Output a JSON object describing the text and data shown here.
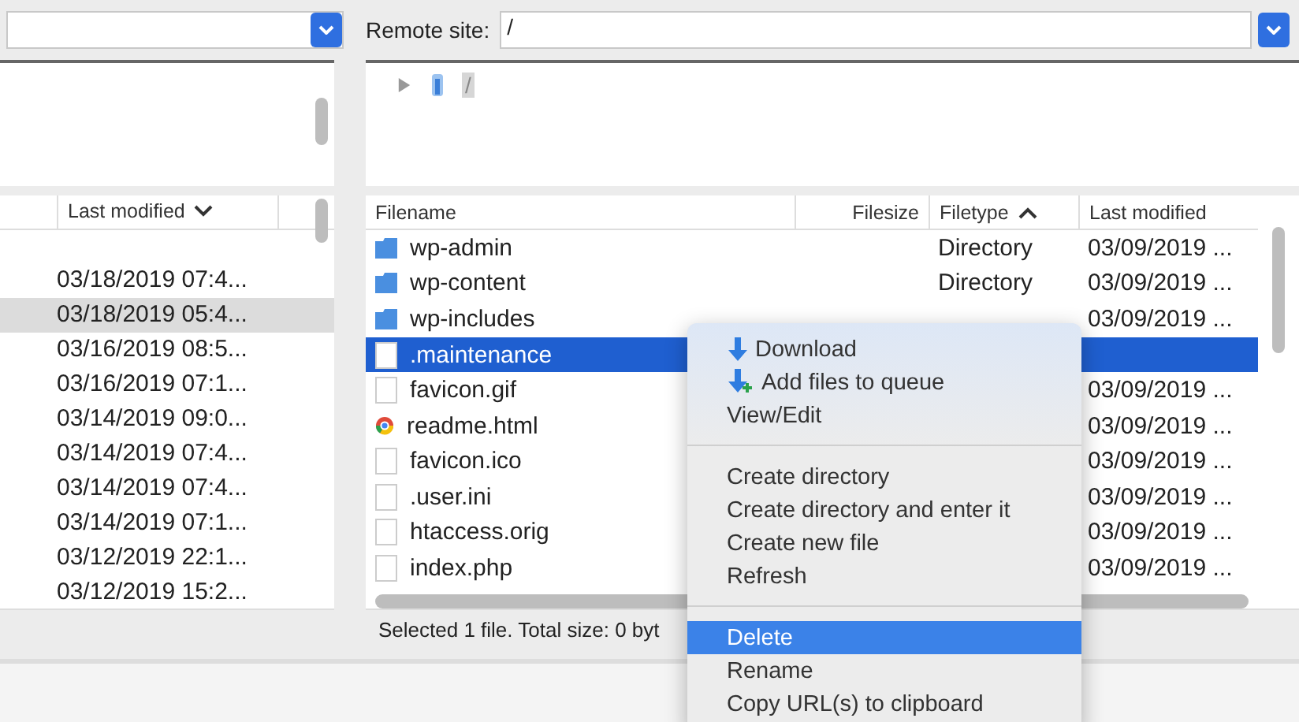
{
  "local_site": {
    "dropdown": {
      "open": false
    }
  },
  "remote_site": {
    "label": "Remote site:",
    "path": "/"
  },
  "remote_tree": [
    {
      "name": "/",
      "expanded": false,
      "selected": true
    }
  ],
  "local_list": {
    "columns": [
      {
        "label": "Last modified",
        "sorted": true,
        "ascending": false
      }
    ],
    "rows": [
      {
        "last_modified": "03/18/2019 07:4...",
        "selected": false
      },
      {
        "last_modified": "03/18/2019 05:4...",
        "selected": true
      },
      {
        "last_modified": "03/16/2019 08:5...",
        "selected": false
      },
      {
        "last_modified": "03/16/2019 07:1...",
        "selected": false
      },
      {
        "last_modified": "03/14/2019 09:0...",
        "selected": false
      },
      {
        "last_modified": "03/14/2019 07:4...",
        "selected": false
      },
      {
        "last_modified": "03/14/2019 07:4...",
        "selected": false
      },
      {
        "last_modified": "03/14/2019 07:1...",
        "selected": false
      },
      {
        "last_modified": "03/12/2019 22:1...",
        "selected": false
      },
      {
        "last_modified": "03/12/2019 15:2...",
        "selected": false
      }
    ]
  },
  "remote_list": {
    "columns": [
      {
        "label": "Filename",
        "sorted": false
      },
      {
        "label": "Filesize",
        "sorted": false
      },
      {
        "label": "Filetype",
        "sorted": true,
        "ascending": true
      },
      {
        "label": "Last modified",
        "sorted": false
      }
    ],
    "rows": [
      {
        "name": "wp-admin",
        "kind": "folder",
        "filetype": "Directory",
        "last_modified": "03/09/2019 ...",
        "selected": false
      },
      {
        "name": "wp-content",
        "kind": "folder",
        "filetype": "Directory",
        "last_modified": "03/09/2019 ...",
        "selected": false
      },
      {
        "name": "wp-includes",
        "kind": "folder",
        "last_modified": "03/09/2019 ...",
        "selected": false
      },
      {
        "name": ".maintenance",
        "kind": "file",
        "selected": true
      },
      {
        "name": "favicon.gif",
        "kind": "file",
        "last_modified": "03/09/2019 ...",
        "selected": false
      },
      {
        "name": "readme.html",
        "kind": "web",
        "last_modified": "03/09/2019 ...",
        "selected": false
      },
      {
        "name": "favicon.ico",
        "kind": "file",
        "last_modified": "03/09/2019 ...",
        "selected": false
      },
      {
        "name": ".user.ini",
        "kind": "file",
        "last_modified": "03/09/2019 ...",
        "selected": false
      },
      {
        "name": "htaccess.orig",
        "kind": "file",
        "last_modified": "03/09/2019 ...",
        "selected": false
      },
      {
        "name": "index.php",
        "kind": "file",
        "last_modified": "03/09/2019 ...",
        "selected": false
      }
    ],
    "status": "Selected 1 file. Total size: 0 byt"
  },
  "context_menu": [
    {
      "kind": "download",
      "label": "Download",
      "selected": false
    },
    {
      "kind": "queue",
      "label": "Add files to queue",
      "selected": false
    },
    {
      "kind": "item",
      "label": "View/Edit",
      "selected": false
    },
    {
      "kind": "separator"
    },
    {
      "kind": "item",
      "label": "Create directory",
      "selected": false
    },
    {
      "kind": "item",
      "label": "Create directory and enter it",
      "selected": false
    },
    {
      "kind": "item",
      "label": "Create new file",
      "selected": false
    },
    {
      "kind": "item",
      "label": "Refresh",
      "selected": false
    },
    {
      "kind": "separator"
    },
    {
      "kind": "item",
      "label": "Delete",
      "selected": true
    },
    {
      "kind": "item",
      "label": "Rename",
      "selected": false
    },
    {
      "kind": "item",
      "label": "Copy URL(s) to clipboard",
      "selected": false
    }
  ]
}
